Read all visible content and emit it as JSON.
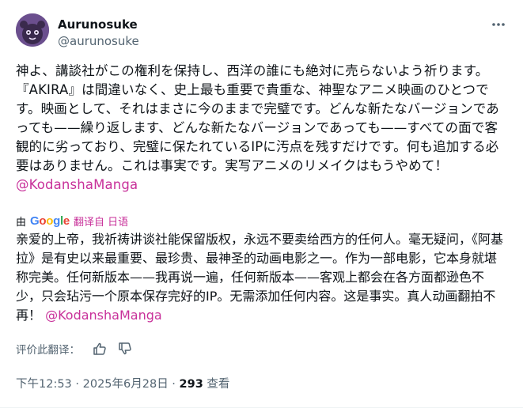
{
  "author": {
    "name": "Aurunosuke",
    "handle": "@aurunosuke"
  },
  "original": {
    "text": "神よ、講談社がこの権利を保持し、西洋の誰にも絶対に売らないよう祈ります。『AKIRA』は間違いなく、史上最も重要で貴重な、神聖なアニメ映画のひとつです。映画として、それはまさに今のままで完璧です。どんな新たなバージョンであっても——繰り返します、どんな新たなバージョンであっても——すべての面で客観的に劣っており、完璧に保たれているIPに汚点を残すだけです。何も追加する必要はありません。これは事実です。実写アニメのリメイクはもうやめて！",
    "mention": "@KodanshaManga"
  },
  "translation": {
    "by_label": "由",
    "provider": "Google",
    "from_label": "翻译自 日语",
    "text": "亲爱的上帝，我祈祷讲谈社能保留版权，永远不要卖给西方的任何人。毫无疑问，《阿基拉》是有史以来最重要、最珍贵、最神圣的动画电影之一。作为一部电影，它本身就堪称完美。任何新版本——我再说一遍，任何新版本——客观上都会在各方面都逊色不少，只会玷污一个原本保存完好的IP。无需添加任何内容。这是事实。真人动画翻拍不再！ ",
    "mention": "@KodanshaManga"
  },
  "rate": {
    "label": "评价此翻译："
  },
  "meta": {
    "time": "下午12:53",
    "sep": " · ",
    "date": "2025年6月28日",
    "views": "293",
    "views_label": " 查看"
  },
  "colors": {
    "mention": "#c8319a",
    "secondary": "#536471",
    "avatar_bg": "#6b4f8e"
  },
  "icons": [
    "avatar-mascot-icon",
    "more-icon",
    "thumbs-up-icon",
    "thumbs-down-icon"
  ]
}
